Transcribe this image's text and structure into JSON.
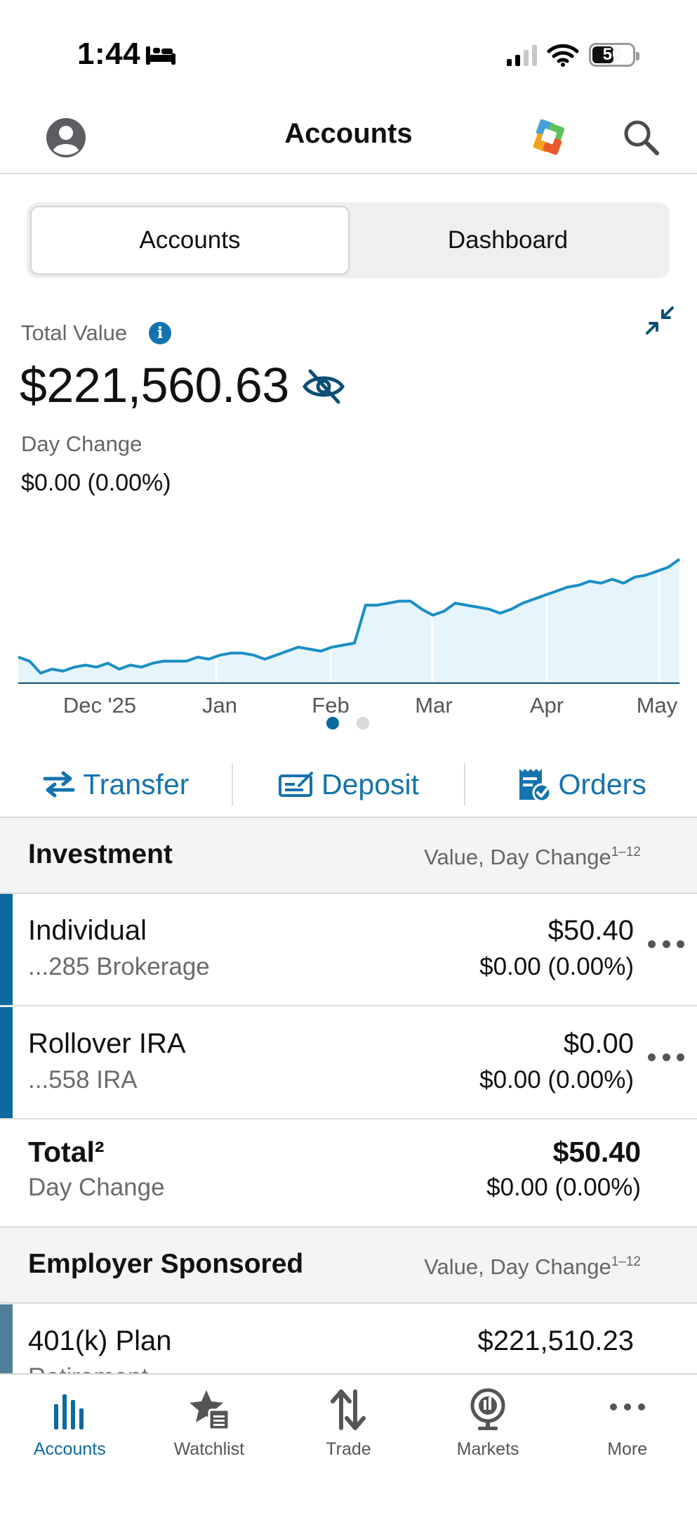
{
  "status_bar": {
    "time": "1:44",
    "battery": "50"
  },
  "header": {
    "title": "Accounts"
  },
  "segmented": {
    "accounts": "Accounts",
    "dashboard": "Dashboard"
  },
  "summary": {
    "total_label": "Total Value",
    "total_value": "$221,560.63",
    "day_change_label": "Day Change",
    "day_change_value": "$0.00 (0.00%)"
  },
  "chart_data": {
    "type": "area",
    "x_tick_labels": [
      "Dec '25",
      "Jan",
      "Feb",
      "Mar",
      "Apr",
      "May"
    ],
    "values": [
      221,
      219,
      213,
      215,
      214,
      216,
      217,
      216,
      218,
      215,
      217,
      216,
      218,
      219,
      219,
      219,
      221,
      220,
      222,
      223,
      223,
      222,
      220,
      222,
      224,
      226,
      225,
      224,
      226,
      227,
      228,
      247,
      247,
      248,
      249,
      249,
      245,
      242,
      244,
      248,
      247,
      246,
      245,
      243,
      245,
      248,
      250,
      252,
      254,
      256,
      257,
      259,
      258,
      260,
      258,
      261,
      262,
      264,
      266,
      270
    ],
    "line_color": "#1a8fc4",
    "fill_color": "#e6f4fb",
    "page_indicator": {
      "pages": 2,
      "active": 0
    }
  },
  "actions": {
    "transfer": "Transfer",
    "deposit": "Deposit",
    "orders": "Orders"
  },
  "investment": {
    "title": "Investment",
    "subtitle": "Value, Day Change",
    "subtitle_sup": "1–12",
    "accounts": [
      {
        "name": "Individual",
        "sub": "...285 Brokerage",
        "value": "$50.40",
        "change": "$0.00 (0.00%)"
      },
      {
        "name": "Rollover IRA",
        "sub": "...558 IRA",
        "value": "$0.00",
        "change": "$0.00 (0.00%)"
      }
    ],
    "total": {
      "label": "Total²",
      "sub": "Day Change",
      "value": "$50.40",
      "change": "$0.00 (0.00%)"
    }
  },
  "employer": {
    "title": "Employer Sponsored",
    "subtitle": "Value, Day Change",
    "subtitle_sup": "1–12",
    "plan": {
      "name": "401(k) Plan",
      "sub": "Retirement",
      "value": "$221,510.23"
    }
  },
  "tabs": [
    {
      "label": "Accounts",
      "icon": "bar-chart-icon"
    },
    {
      "label": "Watchlist",
      "icon": "star-list-icon"
    },
    {
      "label": "Trade",
      "icon": "up-down-arrows-icon"
    },
    {
      "label": "Markets",
      "icon": "globe-chart-icon"
    },
    {
      "label": "More",
      "icon": "more-dots-icon"
    }
  ],
  "colors": {
    "accent": "#1473ad",
    "account_bar": "#0c6a9c"
  }
}
